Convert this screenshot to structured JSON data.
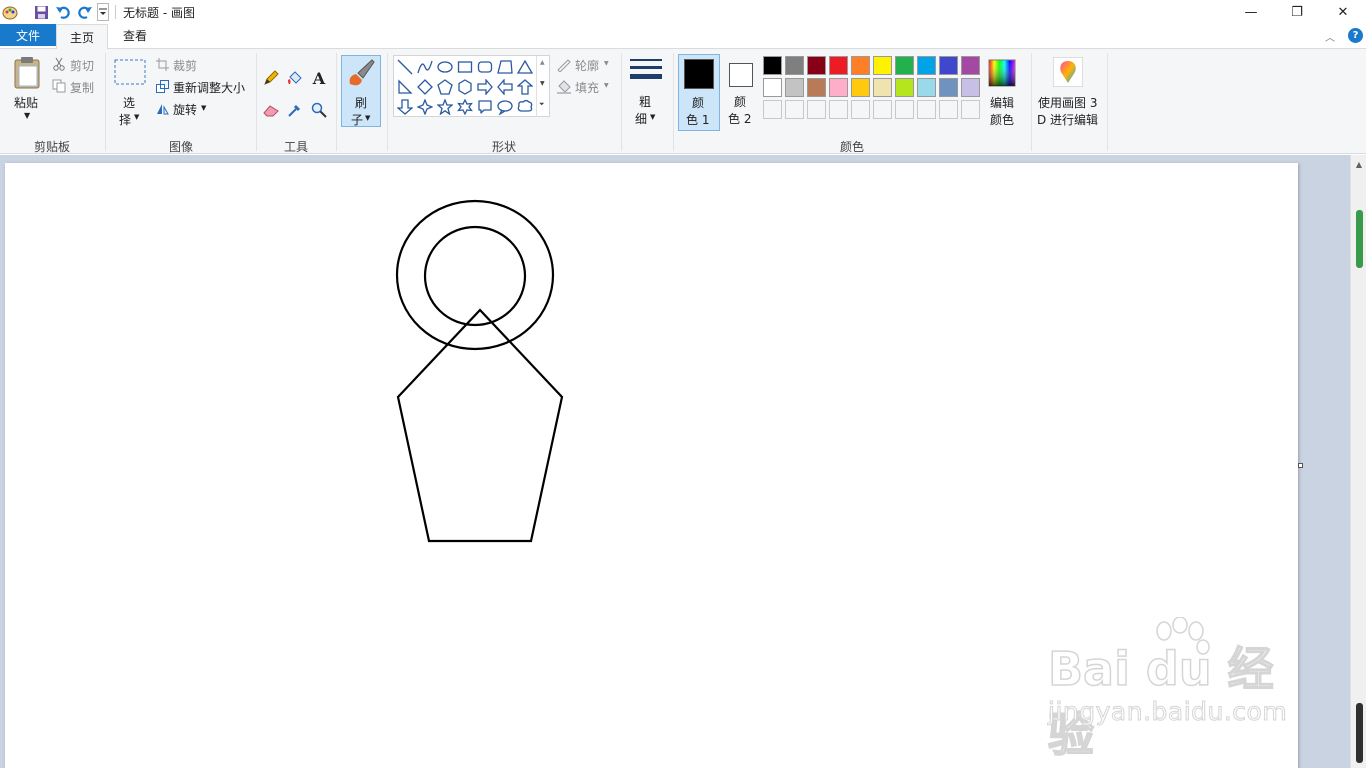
{
  "window": {
    "title": "无标题 - 画图",
    "minimize": "—",
    "maximize": "❐",
    "close": "✕"
  },
  "tabs": {
    "file": "文件",
    "home": "主页",
    "view": "查看"
  },
  "ribbon": {
    "clipboard": {
      "paste": "粘贴",
      "cut": "剪切",
      "copy": "复制",
      "group": "剪贴板"
    },
    "image": {
      "select_line1": "选",
      "select_line2": "择",
      "crop": "裁剪",
      "resize": "重新调整大小",
      "rotate": "旋转",
      "group": "图像"
    },
    "tools": {
      "group": "工具"
    },
    "brushes": {
      "line1": "刷",
      "line2": "子"
    },
    "shapes": {
      "outline": "轮廓",
      "fill": "填充",
      "group": "形状"
    },
    "size": {
      "line1": "粗",
      "line2": "细"
    },
    "colors": {
      "color1_line1": "颜",
      "color1_line2": "色 1",
      "color2_line1": "颜",
      "color2_line2": "色 2",
      "edit_line1": "编辑",
      "edit_line2": "颜色",
      "group": "颜色",
      "color1_value": "#000000",
      "color2_value": "#ffffff",
      "palette_row1": [
        "#000000",
        "#7f7f7f",
        "#880015",
        "#ed1c24",
        "#ff7f27",
        "#fff200",
        "#22b14c",
        "#00a2e8",
        "#3f48cc",
        "#a349a4"
      ],
      "palette_row2": [
        "#ffffff",
        "#c3c3c3",
        "#b97a57",
        "#ffaec9",
        "#ffc90e",
        "#efe4b0",
        "#b5e61d",
        "#99d9ea",
        "#7092be",
        "#c8bfe7"
      ]
    },
    "paint3d": {
      "line1": "使用画图 3",
      "line2": "D 进行编辑"
    }
  },
  "watermark": {
    "brand": "Bai du 经验",
    "url": "jingyan.baidu.com"
  }
}
